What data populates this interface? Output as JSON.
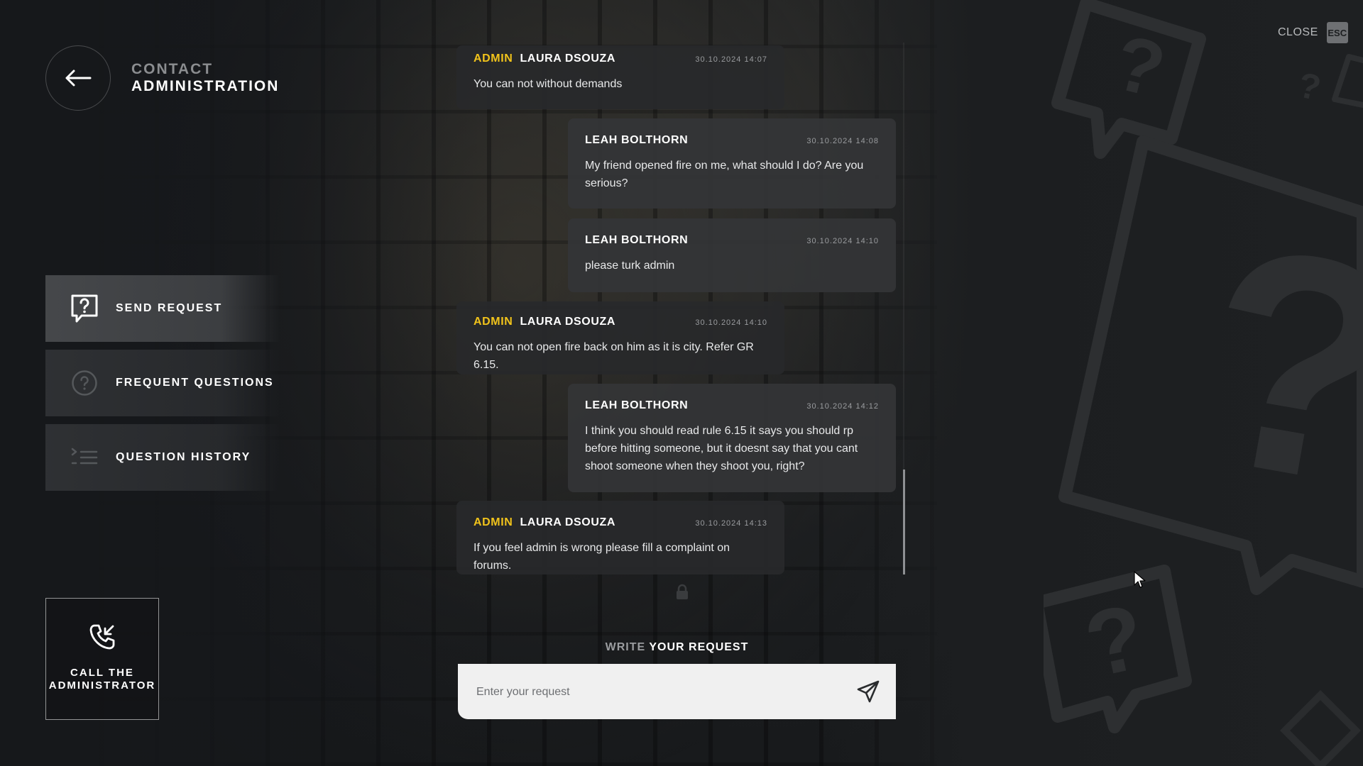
{
  "header": {
    "title_line1": "CONTACT",
    "title_line2": "ADMINISTRATION"
  },
  "close": {
    "label": "CLOSE",
    "key": "ESC"
  },
  "menu": {
    "items": [
      {
        "label": "SEND REQUEST",
        "icon": "question-bubble-icon",
        "active": true
      },
      {
        "label": "FREQUENT QUESTIONS",
        "icon": "question-circle-icon",
        "active": false
      },
      {
        "label": "QUESTION HISTORY",
        "icon": "list-icon",
        "active": false
      }
    ]
  },
  "call": {
    "label_line1": "CALL THE",
    "label_line2": "ADMINISTRATOR",
    "icon": "phone-incoming-icon"
  },
  "messages": [
    {
      "role": "ADMIN",
      "author": "LAURA DSOUZA",
      "time": "30.10.2024 14:07",
      "text": "You can not without demands",
      "side": "admin"
    },
    {
      "role": "",
      "author": "LEAH BOLTHORN",
      "time": "30.10.2024 14:08",
      "text": "My friend opened fire on me, what should I do? Are you serious?",
      "side": "user"
    },
    {
      "role": "",
      "author": "LEAH BOLTHORN",
      "time": "30.10.2024 14:10",
      "text": "please turk admin",
      "side": "user"
    },
    {
      "role": "ADMIN",
      "author": "LAURA DSOUZA",
      "time": "30.10.2024 14:10",
      "text": "You can not open fire back on him as it is city. Refer GR 6.15.",
      "side": "admin"
    },
    {
      "role": "",
      "author": "LEAH BOLTHORN",
      "time": "30.10.2024 14:12",
      "text": "I think you should read rule 6.15 it says you should rp before hitting someone, but it doesnt say that you cant shoot someone when they shoot you, right?",
      "side": "user"
    },
    {
      "role": "ADMIN",
      "author": "LAURA DSOUZA",
      "time": "30.10.2024 14:13",
      "text": "If you feel admin is wrong please fill a complaint on forums.",
      "side": "admin"
    }
  ],
  "compose": {
    "heading_muted": "WRITE",
    "heading_strong": "YOUR REQUEST",
    "placeholder": "Enter your request",
    "value": ""
  },
  "colors": {
    "accent_yellow": "#f1c31b",
    "background": "#1c1e20",
    "input_bg": "#f0f0f0"
  }
}
